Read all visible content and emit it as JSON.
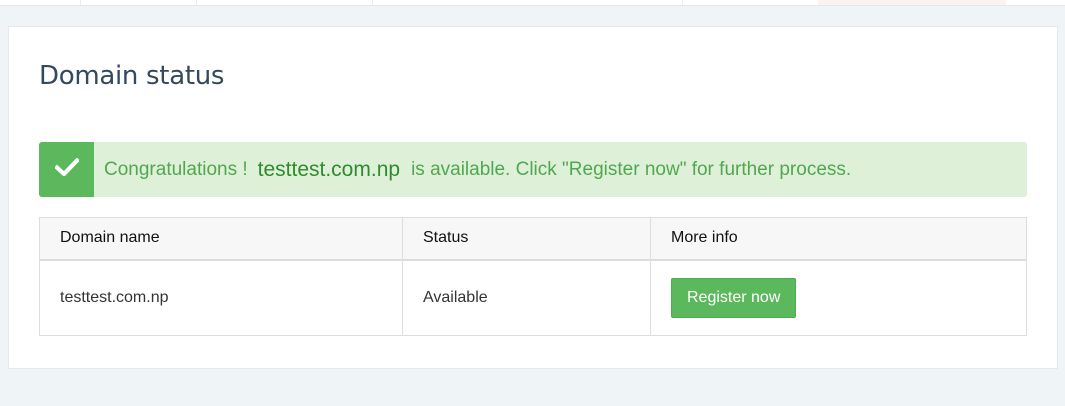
{
  "page": {
    "title": "Domain status"
  },
  "alert": {
    "prefix": "Congratulations !",
    "domain": "testtest.com.np",
    "suffix": "is available. Click \"Register now\" for further process.",
    "icon": "check-icon"
  },
  "table": {
    "headers": [
      "Domain name",
      "Status",
      "More info"
    ],
    "rows": [
      {
        "domain": "testtest.com.np",
        "status": "Available",
        "action_label": "Register now"
      }
    ]
  },
  "colors": {
    "success": "#5cb85c",
    "alert_background": "#dff0d8",
    "title": "#34495e",
    "page_background": "#eff4f6"
  }
}
